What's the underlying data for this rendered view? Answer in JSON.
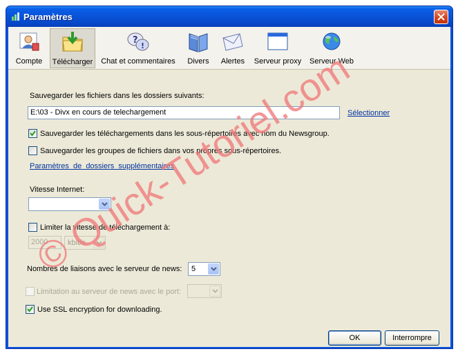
{
  "window": {
    "title": "Paramètres"
  },
  "toolbar": {
    "items": [
      {
        "label": "Compte",
        "icon": "account-icon"
      },
      {
        "label": "Télécharger",
        "icon": "download-folder-icon"
      },
      {
        "label": "Chat et commentaires",
        "icon": "chat-help-icon"
      },
      {
        "label": "Divers",
        "icon": "book-icon"
      },
      {
        "label": "Alertes",
        "icon": "envelope-icon"
      },
      {
        "label": "Serveur proxy",
        "icon": "window-icon"
      },
      {
        "label": "Serveur Web",
        "icon": "globe-icon"
      }
    ],
    "active": "Télécharger"
  },
  "download": {
    "folders_label": "Sauvegarder les fichiers dans les dossiers suivants:",
    "folder_value": "E:\\03 - Divx en cours de telechargement",
    "select_link": "Sélectionner",
    "subdir_newsgroup_label": "Sauvegarder les téléchargements dans les sous-répertoires avec nom du Newsgroup.",
    "subdir_newsgroup_checked": true,
    "subdir_groups_label": "Sauvegarder les groupes de fichiers dans vos propres sous-répertoires.",
    "subdir_groups_checked": false,
    "extra_folders_link": "Paramètres  de  dossiers  supplémentaires",
    "internet_speed_label": "Vitesse Internet:",
    "internet_speed_value": "",
    "limit_speed_label": "Limiter la vitesse de téléchargement à:",
    "limit_speed_checked": false,
    "limit_value": "2000",
    "limit_unit": "kbit/s",
    "connections_label": "Nombres de liaisons avec le serveur de news:",
    "connections_value": "5",
    "port_limit_label": "Limitation au serveur de news avec le port:",
    "port_limit_checked": false,
    "port_value": "",
    "ssl_label": "Use SSL encryption for downloading.",
    "ssl_checked": true
  },
  "footer": {
    "ok_label": "OK",
    "cancel_label": "Interrompre"
  },
  "watermark": {
    "text": "© Quick-Tutoriel.com",
    "color": "#f07a7a"
  },
  "colors": {
    "titlebar": "#0a52d8",
    "client": "#ece9d8",
    "link": "#0033a0"
  }
}
